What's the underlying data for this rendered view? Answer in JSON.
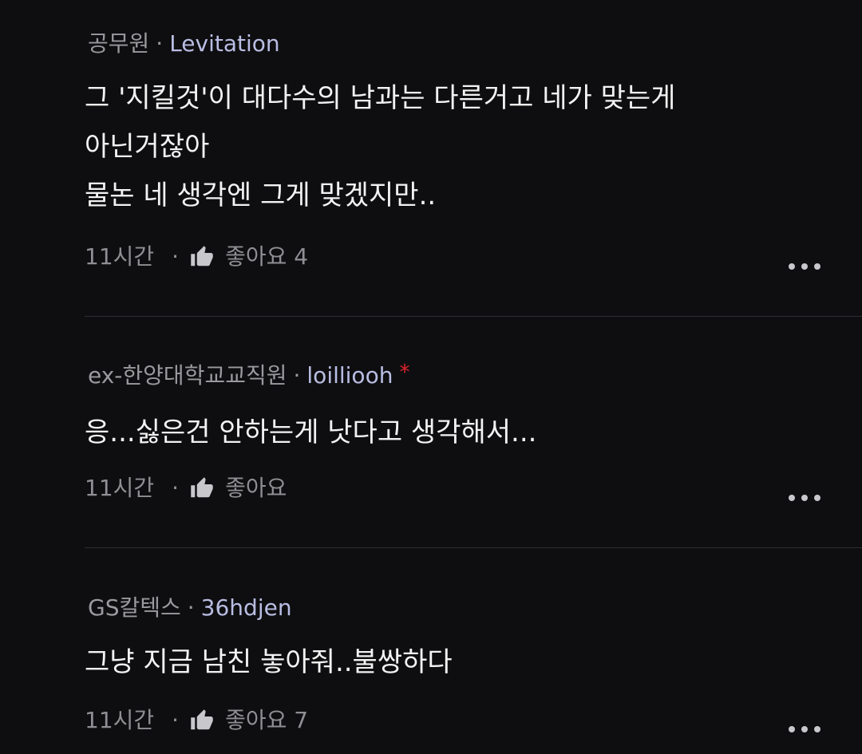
{
  "comments": [
    {
      "company": "공무원",
      "nickname": "Levitation",
      "lines": [
        "그 '지킬것'이 대다수의 남과는 다른거고 네가 맞는게",
        "아닌거잖아",
        "물논 네 생각엔 그게 맞겠지만.."
      ],
      "time": "11시간",
      "like_label": "좋아요 4"
    },
    {
      "company": "ex-한양대학교교직원",
      "nickname": "loilliooh",
      "marker": "*",
      "lines": [
        "응...싫은건 안하는게 낫다고 생각해서..."
      ],
      "time": "11시간",
      "like_label": "좋아요"
    },
    {
      "company": "GS칼텍스",
      "nickname": "36hdjen",
      "lines": [
        "그냥 지금 남친 놓아줘..불쌍하다"
      ],
      "time": "11시간",
      "like_label": "좋아요 7"
    }
  ],
  "separator": "·",
  "icons": {
    "like": "thumbs-up-icon",
    "more": "more-horizontal-icon"
  },
  "colors": {
    "background": "#0e0e10",
    "nickname": "#b9bde3",
    "marker": "#e0222b"
  }
}
